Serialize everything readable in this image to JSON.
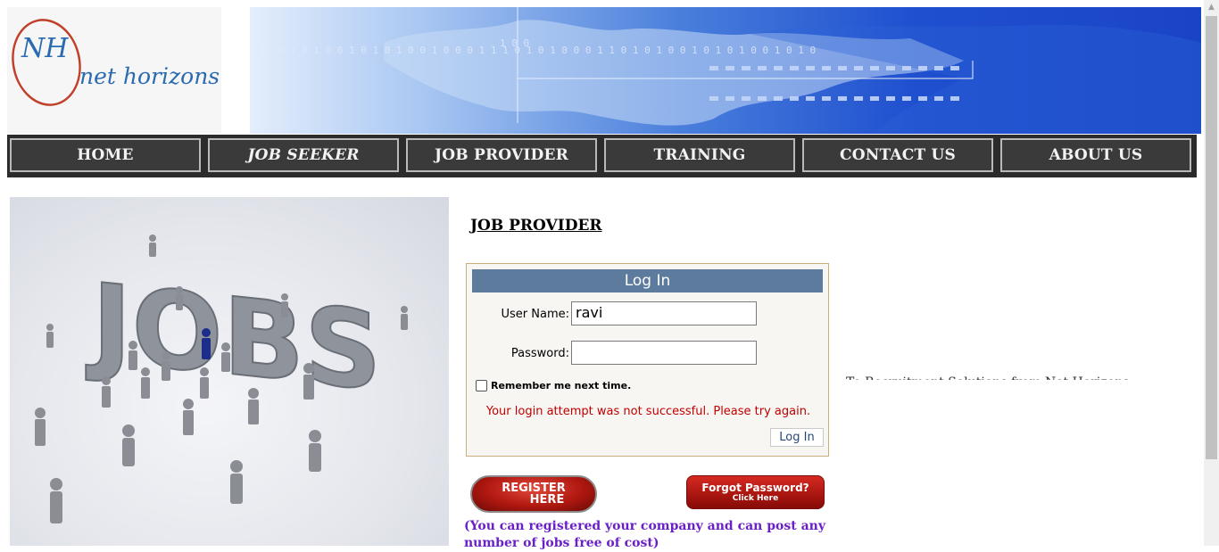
{
  "header": {
    "logo_monogram": "NH",
    "logo_text": "net horizons"
  },
  "nav": {
    "items": [
      {
        "label": "HOME"
      },
      {
        "label": "JOB SEEKER"
      },
      {
        "label": "JOB PROVIDER"
      },
      {
        "label": "TRAINING"
      },
      {
        "label": "CONTACT US"
      },
      {
        "label": "ABOUT US"
      }
    ]
  },
  "hero": {
    "image_word": "JOBS"
  },
  "page": {
    "heading": "JOB PROVIDER"
  },
  "login": {
    "title": "Log In",
    "username_label": "User Name:",
    "username_value": "ravi",
    "password_label": "Password:",
    "password_value": "",
    "remember_label": "Remember me next time.",
    "remember_checked": false,
    "error_message": "Your login attempt was not successful. Please try again.",
    "submit_label": "Log In"
  },
  "actions": {
    "register_line1": "REGISTER",
    "register_line2": "HERE",
    "forgot_line1": "Forgot Password?",
    "forgot_line2": "Click Here"
  },
  "note": "(You can registered your company and can post any number of jobs free of cost)",
  "marquee_text": "To Recruitment Solutions from Net Horizons ....We",
  "colors": {
    "nav_bg": "#3a3a3a",
    "login_title_bg": "#5d7b9d",
    "error": "#c00000",
    "note": "#6a1fc8"
  }
}
